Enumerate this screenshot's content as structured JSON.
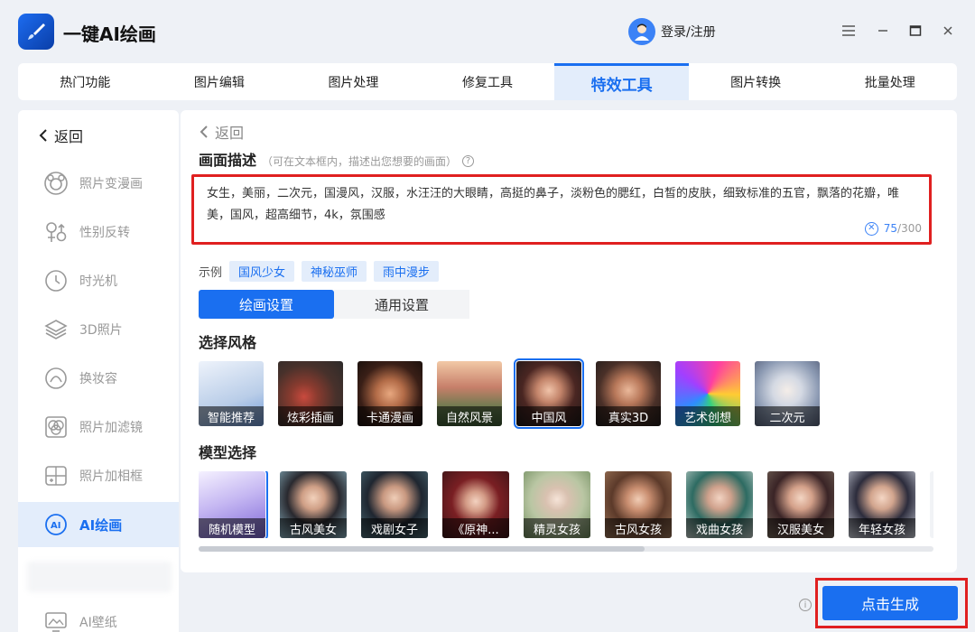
{
  "app": {
    "title": "一键AI绘画"
  },
  "user": {
    "login_label": "登录/注册"
  },
  "tabs": [
    {
      "label": "热门功能"
    },
    {
      "label": "图片编辑"
    },
    {
      "label": "图片处理"
    },
    {
      "label": "修复工具"
    },
    {
      "label": "特效工具"
    },
    {
      "label": "图片转换"
    },
    {
      "label": "批量处理"
    }
  ],
  "active_tab": "特效工具",
  "sidebar": {
    "back_label": "返回",
    "items": [
      {
        "label": "照片变漫画",
        "icon": "cartoon-face-icon"
      },
      {
        "label": "性别反转",
        "icon": "gender-icon"
      },
      {
        "label": "时光机",
        "icon": "clock-icon"
      },
      {
        "label": "3D照片",
        "icon": "layers-icon"
      },
      {
        "label": "换妆容",
        "icon": "makeup-icon"
      },
      {
        "label": "照片加滤镜",
        "icon": "filter-icon"
      },
      {
        "label": "照片加相框",
        "icon": "frame-icon"
      },
      {
        "label": "AI绘画",
        "icon": "ai-paint-icon"
      },
      {
        "label": "AI壁纸",
        "icon": "wallpaper-icon"
      }
    ],
    "active": "AI绘画"
  },
  "main": {
    "back_label": "返回",
    "desc_title": "画面描述",
    "desc_hint": "（可在文本框内，描述出您想要的画面）",
    "desc_text": "女生，美丽，二次元，国漫风，汉服，水汪汪的大眼睛，高挺的鼻子，淡粉色的腮红，白皙的皮肤，细致标准的五官，飘落的花瓣，唯美，国风，超高细节，4k，氛围感",
    "char_count": "75",
    "char_max": "/300",
    "examples_label": "示例",
    "examples": [
      "国风少女",
      "神秘巫师",
      "雨中漫步"
    ],
    "settings_tabs": [
      "绘画设置",
      "通用设置"
    ],
    "style_title": "选择风格",
    "styles": [
      "智能推荐",
      "炫彩插画",
      "卡通漫画",
      "自然风景",
      "中国风",
      "真实3D",
      "艺术创想",
      "二次元"
    ],
    "selected_style": "中国风",
    "model_title": "模型选择",
    "models": [
      "随机模型",
      "古风美女",
      "戏剧女子",
      "《原神...",
      "精灵女孩",
      "古风女孩",
      "戏曲女孩",
      "汉服美女",
      "年轻女孩"
    ],
    "selected_model": "随机模型"
  },
  "generate_label": "点击生成",
  "colors": {
    "accent": "#1a6ff0",
    "highlight_red": "#e02020"
  }
}
